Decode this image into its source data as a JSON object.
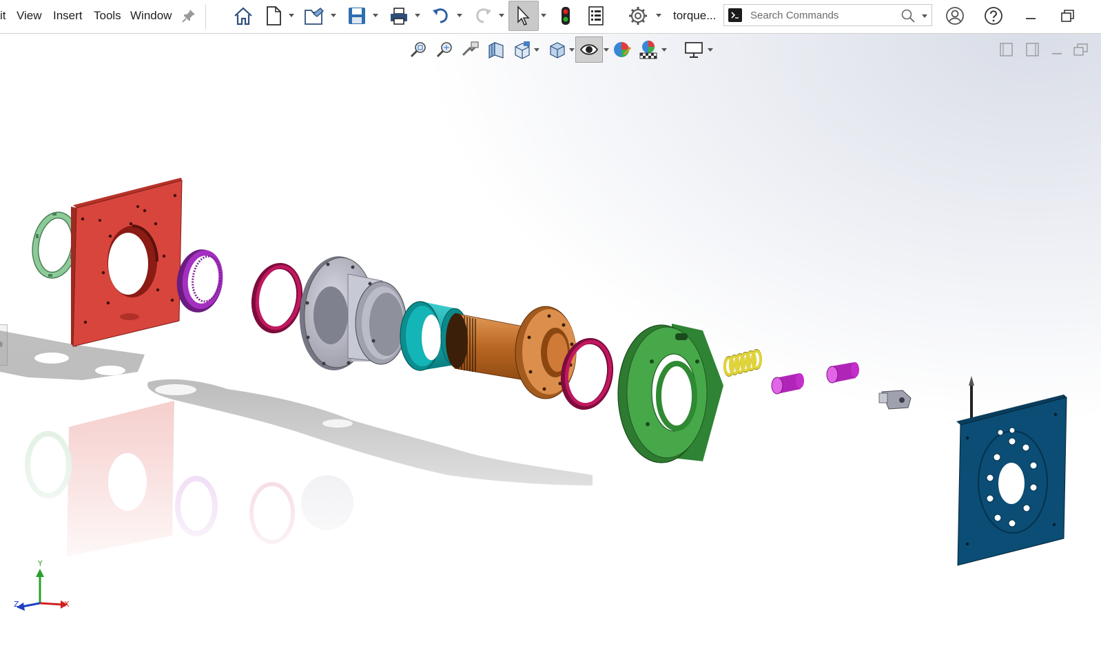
{
  "menu": {
    "items": [
      {
        "name": "edit",
        "label": "it"
      },
      {
        "name": "view",
        "label": "View"
      },
      {
        "name": "insert",
        "label": "Insert"
      },
      {
        "name": "tools",
        "label": "Tools"
      },
      {
        "name": "window",
        "label": "Window"
      }
    ]
  },
  "toolbar": {
    "icons": [
      "pin-icon",
      "home-icon",
      "new-document-icon",
      "open-folder-icon",
      "save-icon",
      "print-icon",
      "undo-icon",
      "redo-icon",
      "select-arrow-icon",
      "rebuild-traffic-light-icon",
      "file-properties-icon",
      "options-gear-icon"
    ],
    "document_title": "torque...",
    "search": {
      "placeholder": "Search Commands"
    },
    "right_icons": [
      "user-account-icon",
      "help-icon",
      "minimize-icon",
      "restore-icon"
    ]
  },
  "view_toolbar": {
    "icons": [
      "zoom-to-fit-icon",
      "zoom-to-area-icon",
      "previous-view-icon",
      "section-view-icon",
      "view-orientation-icon",
      "display-style-icon",
      "hide-show-items-icon",
      "edit-appearance-icon",
      "apply-scene-icon",
      "view-settings-icon"
    ],
    "right_icons": [
      "viewport-left-icon",
      "viewport-right-icon",
      "viewport-minimize-icon",
      "viewport-restore-icon"
    ]
  },
  "triad": {
    "x_label": "X",
    "y_label": "Y",
    "z_label": "Z"
  },
  "colors": {
    "plate_red": "#d8453d",
    "plate_blue": "#0b4d74",
    "ring_green": "#7fc08c",
    "bearing_purple": "#a42fc0",
    "seal_magenta": "#c0185f",
    "housing_gray": "#a9abb8",
    "sleeve_teal": "#11a6a8",
    "shaft_bronze": "#cc7b3a",
    "flange_green": "#47a84a",
    "spring_yellow": "#d0c528",
    "pin_magenta": "#d235d8",
    "toolbar_bg": "#ffffff"
  }
}
